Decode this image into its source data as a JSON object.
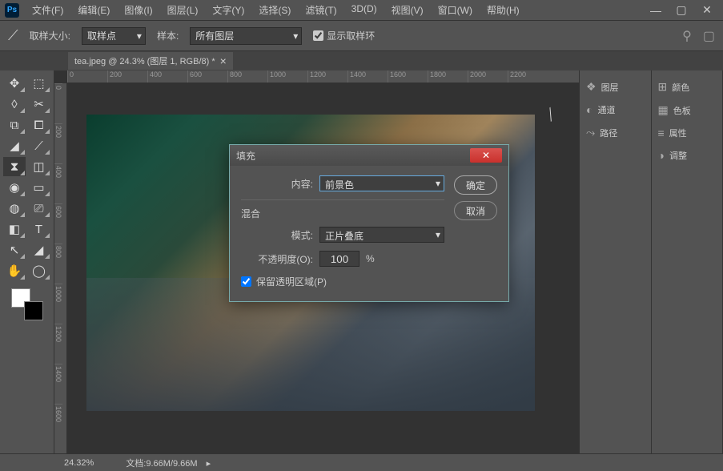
{
  "menu": [
    "文件(F)",
    "编辑(E)",
    "图像(I)",
    "图层(L)",
    "文字(Y)",
    "选择(S)",
    "滤镜(T)",
    "3D(D)",
    "视图(V)",
    "窗口(W)",
    "帮助(H)"
  ],
  "optbar": {
    "sample_size_label": "取样大小:",
    "sample_size_value": "取样点",
    "sample_label": "样本:",
    "sample_value": "所有图层",
    "show_ring": "显示取样环",
    "show_ring_checked": true
  },
  "doc_tab": "tea.jpeg @ 24.3% (图层 1, RGB/8) *",
  "ruler_h": [
    "0",
    "200",
    "400",
    "600",
    "800",
    "1000",
    "1200",
    "1400",
    "1600",
    "1800",
    "2000",
    "2200"
  ],
  "ruler_v": [
    "0",
    "200",
    "400",
    "600",
    "800",
    "1000",
    "1200",
    "1400",
    "1600"
  ],
  "panels_left": [
    {
      "icon": "❖",
      "label": "图层"
    },
    {
      "icon": "◐",
      "label": "通道"
    },
    {
      "icon": "⤳",
      "label": "路径"
    }
  ],
  "panels_right": [
    {
      "icon": "⊞",
      "label": "颜色"
    },
    {
      "icon": "▦",
      "label": "色板"
    },
    {
      "icon": "≡",
      "label": "属性"
    },
    {
      "icon": "◑",
      "label": "调整"
    }
  ],
  "dialog": {
    "title": "填充",
    "content_label": "内容:",
    "content_value": "前景色",
    "blend_label": "混合",
    "mode_label": "模式:",
    "mode_value": "正片叠底",
    "opacity_label": "不透明度(O):",
    "opacity_value": "100",
    "opacity_unit": "%",
    "preserve_label": "保留透明区域(P)",
    "preserve_checked": true,
    "ok": "确定",
    "cancel": "取消"
  },
  "status": {
    "zoom": "24.32%",
    "doc_label": "文档:",
    "doc_value": "9.66M/9.66M"
  },
  "tools": [
    "✥",
    "⬚",
    "◊",
    "✂",
    "⧉",
    "⧠",
    "◢",
    "⟋",
    "⧗",
    "◫",
    "◉",
    "▭",
    "◍",
    "⎚",
    "◧",
    "T",
    "↖",
    "◢",
    "✋",
    "◯"
  ],
  "colors": {
    "fg": "#ffffff",
    "bg": "#000000"
  }
}
